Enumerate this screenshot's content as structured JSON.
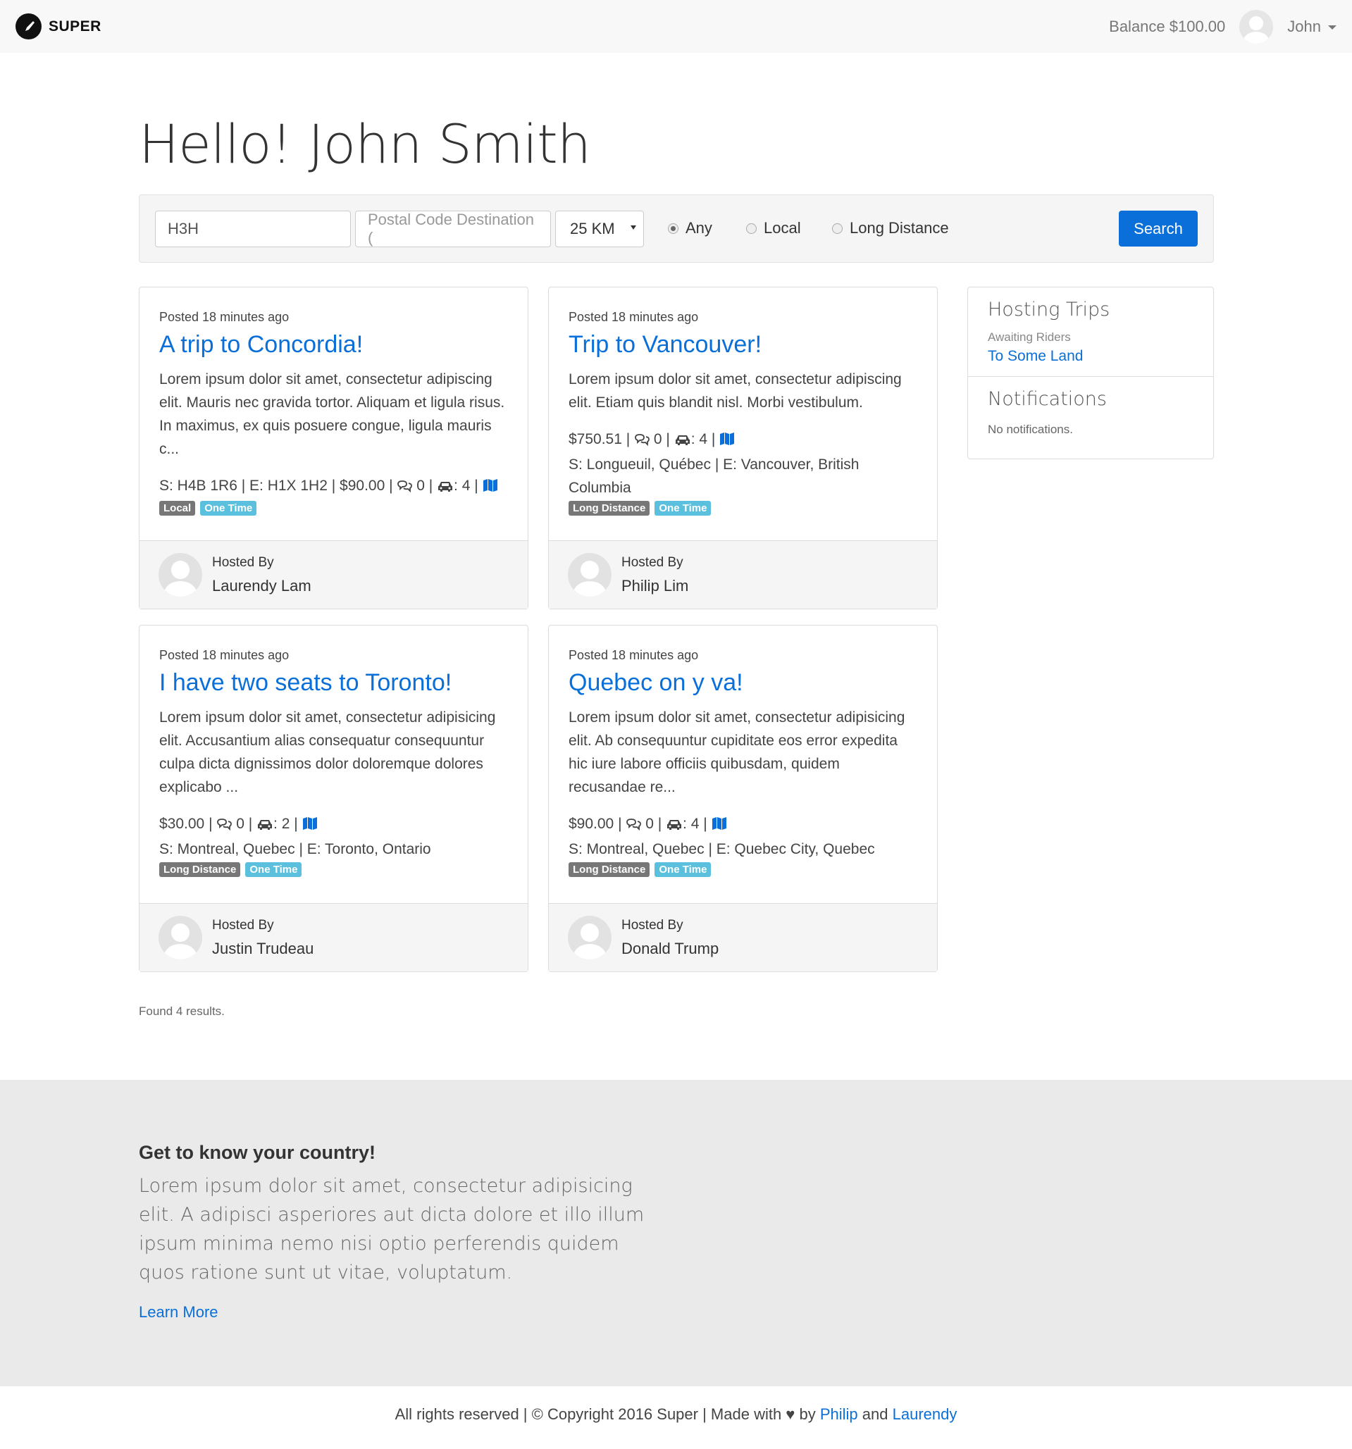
{
  "navbar": {
    "brand": "SUPER",
    "balance": "Balance $100.00",
    "user_name": "John"
  },
  "page_title": "Hello! John Smith",
  "search": {
    "origin_value": "H3H",
    "destination_placeholder": "Postal Code Destination (",
    "radius": "25 KM",
    "trip_types": [
      "Any",
      "Local",
      "Long Distance"
    ],
    "selected_trip_type": "Any",
    "button_label": "Search"
  },
  "trips": [
    {
      "posted": "Posted 18 minutes ago",
      "title": "A trip to Concordia!",
      "description": "Lorem ipsum dolor sit amet, consectetur adipiscing elit. Mauris nec gravida tortor. Aliquam et ligula risus. In maximus, ex quis posuere congue, ligula mauris c...",
      "route_start": "S: H4B 1R6",
      "route_end": "E: H1X 1H2",
      "price": "$90.00",
      "comments": "0",
      "seats": "4",
      "badges": [
        "Local",
        "One Time"
      ],
      "host_label": "Hosted By",
      "host_name": "Laurendy Lam"
    },
    {
      "posted": "Posted 18 minutes ago",
      "title": "Trip to Vancouver!",
      "description": "Lorem ipsum dolor sit amet, consectetur adipiscing elit. Etiam quis blandit nisl. Morbi vestibulum.",
      "route_start": "S: Longueuil, Québec",
      "route_end": "E: Vancouver, British Columbia",
      "price": "$750.51",
      "comments": "0",
      "seats": "4",
      "badges": [
        "Long Distance",
        "One Time"
      ],
      "host_label": "Hosted By",
      "host_name": "Philip Lim"
    },
    {
      "posted": "Posted 18 minutes ago",
      "title": "I have two seats to Toronto!",
      "description": "Lorem ipsum dolor sit amet, consectetur adipisicing elit. Accusantium alias consequatur consequuntur culpa dicta dignissimos dolor doloremque dolores explicabo ...",
      "route_start": "S: Montreal, Quebec",
      "route_end": "E: Toronto, Ontario",
      "price": "$30.00",
      "comments": "0",
      "seats": "2",
      "badges": [
        "Long Distance",
        "One Time"
      ],
      "host_label": "Hosted By",
      "host_name": "Justin Trudeau"
    },
    {
      "posted": "Posted 18 minutes ago",
      "title": "Quebec on y va!",
      "description": "Lorem ipsum dolor sit amet, consectetur adipisicing elit. Ab consequuntur cupiditate eos error expedita hic iure labore officiis quibusdam, quidem recusandae re...",
      "route_start": "S: Montreal, Quebec",
      "route_end": "E: Quebec City, Quebec",
      "price": "$90.00",
      "comments": "0",
      "seats": "4",
      "badges": [
        "Long Distance",
        "One Time"
      ],
      "host_label": "Hosted By",
      "host_name": "Donald Trump"
    }
  ],
  "sidebar": {
    "hosting_title": "Hosting Trips",
    "hosting_status": "Awaiting Riders",
    "hosting_trip": "To Some Land",
    "notifications_title": "Notifications",
    "notifications_empty": "No notifications."
  },
  "results_text": "Found 4 results.",
  "jumbotron": {
    "title": "Get to know your country!",
    "text": "Lorem ipsum dolor sit amet, consectetur adipisicing elit. A adipisci asperiores aut dicta dolore et illo illum ipsum minima nemo nisi optio perferendis quidem quos ratione sunt ut vitae, voluptatum.",
    "link": "Learn More"
  },
  "footer": {
    "text": "All rights reserved | © Copyright 2016 Super | Made with ♥ by",
    "author1": "Philip",
    "joiner": "and",
    "author2": "Laurendy"
  },
  "colors": {
    "accent": "#0a6fd8",
    "badge_gray": "#777777",
    "badge_blue": "#5bc0de"
  }
}
